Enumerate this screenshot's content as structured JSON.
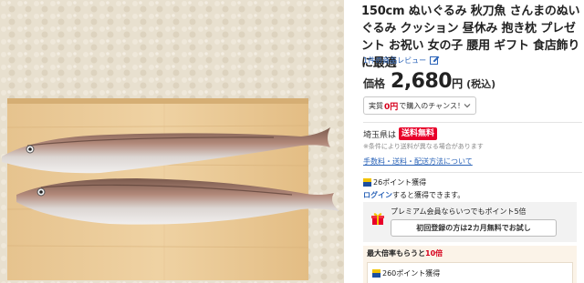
{
  "product": {
    "title": "150cm ぬいぐるみ 秋刀魚 さんまのぬいぐるみ クッション 昼休み 抱き枕 プレゼント お祝い 女の子 腰用 ギフト 食店飾りに最適",
    "review_text": "1件の商品レビュー",
    "price_label": "価格",
    "price_value": "2,680",
    "price_unit": "円",
    "price_tax": "(税込)"
  },
  "chance": {
    "prefix": "実質",
    "zero": "0円",
    "suffix": "で購入のチャンス！"
  },
  "shipping": {
    "region": "埼玉県は",
    "badge": "送料無料",
    "note": "※条件により送料が異なる場合があります",
    "link": "手数料・送料・配送方法について"
  },
  "points": {
    "earned": "26ポイント獲得",
    "login_link": "ログイン",
    "login_suffix": "すると獲得できます。"
  },
  "premium": {
    "text": "プレミアム会員ならいつでもポイント5倍",
    "trial_button": "初回登録の方は2カ月無料でお試し"
  },
  "max_rate": {
    "prefix": "最大倍率もらうと",
    "highlight": "10倍",
    "points": "260ポイント獲得"
  },
  "icons": {
    "edit": "edit-icon",
    "chevron": "chevron-down-icon",
    "tpoint": "t-point-icon",
    "gift": "gift-icon"
  },
  "colors": {
    "accent_red": "#e8002a",
    "link_blue": "#2a63b8"
  }
}
